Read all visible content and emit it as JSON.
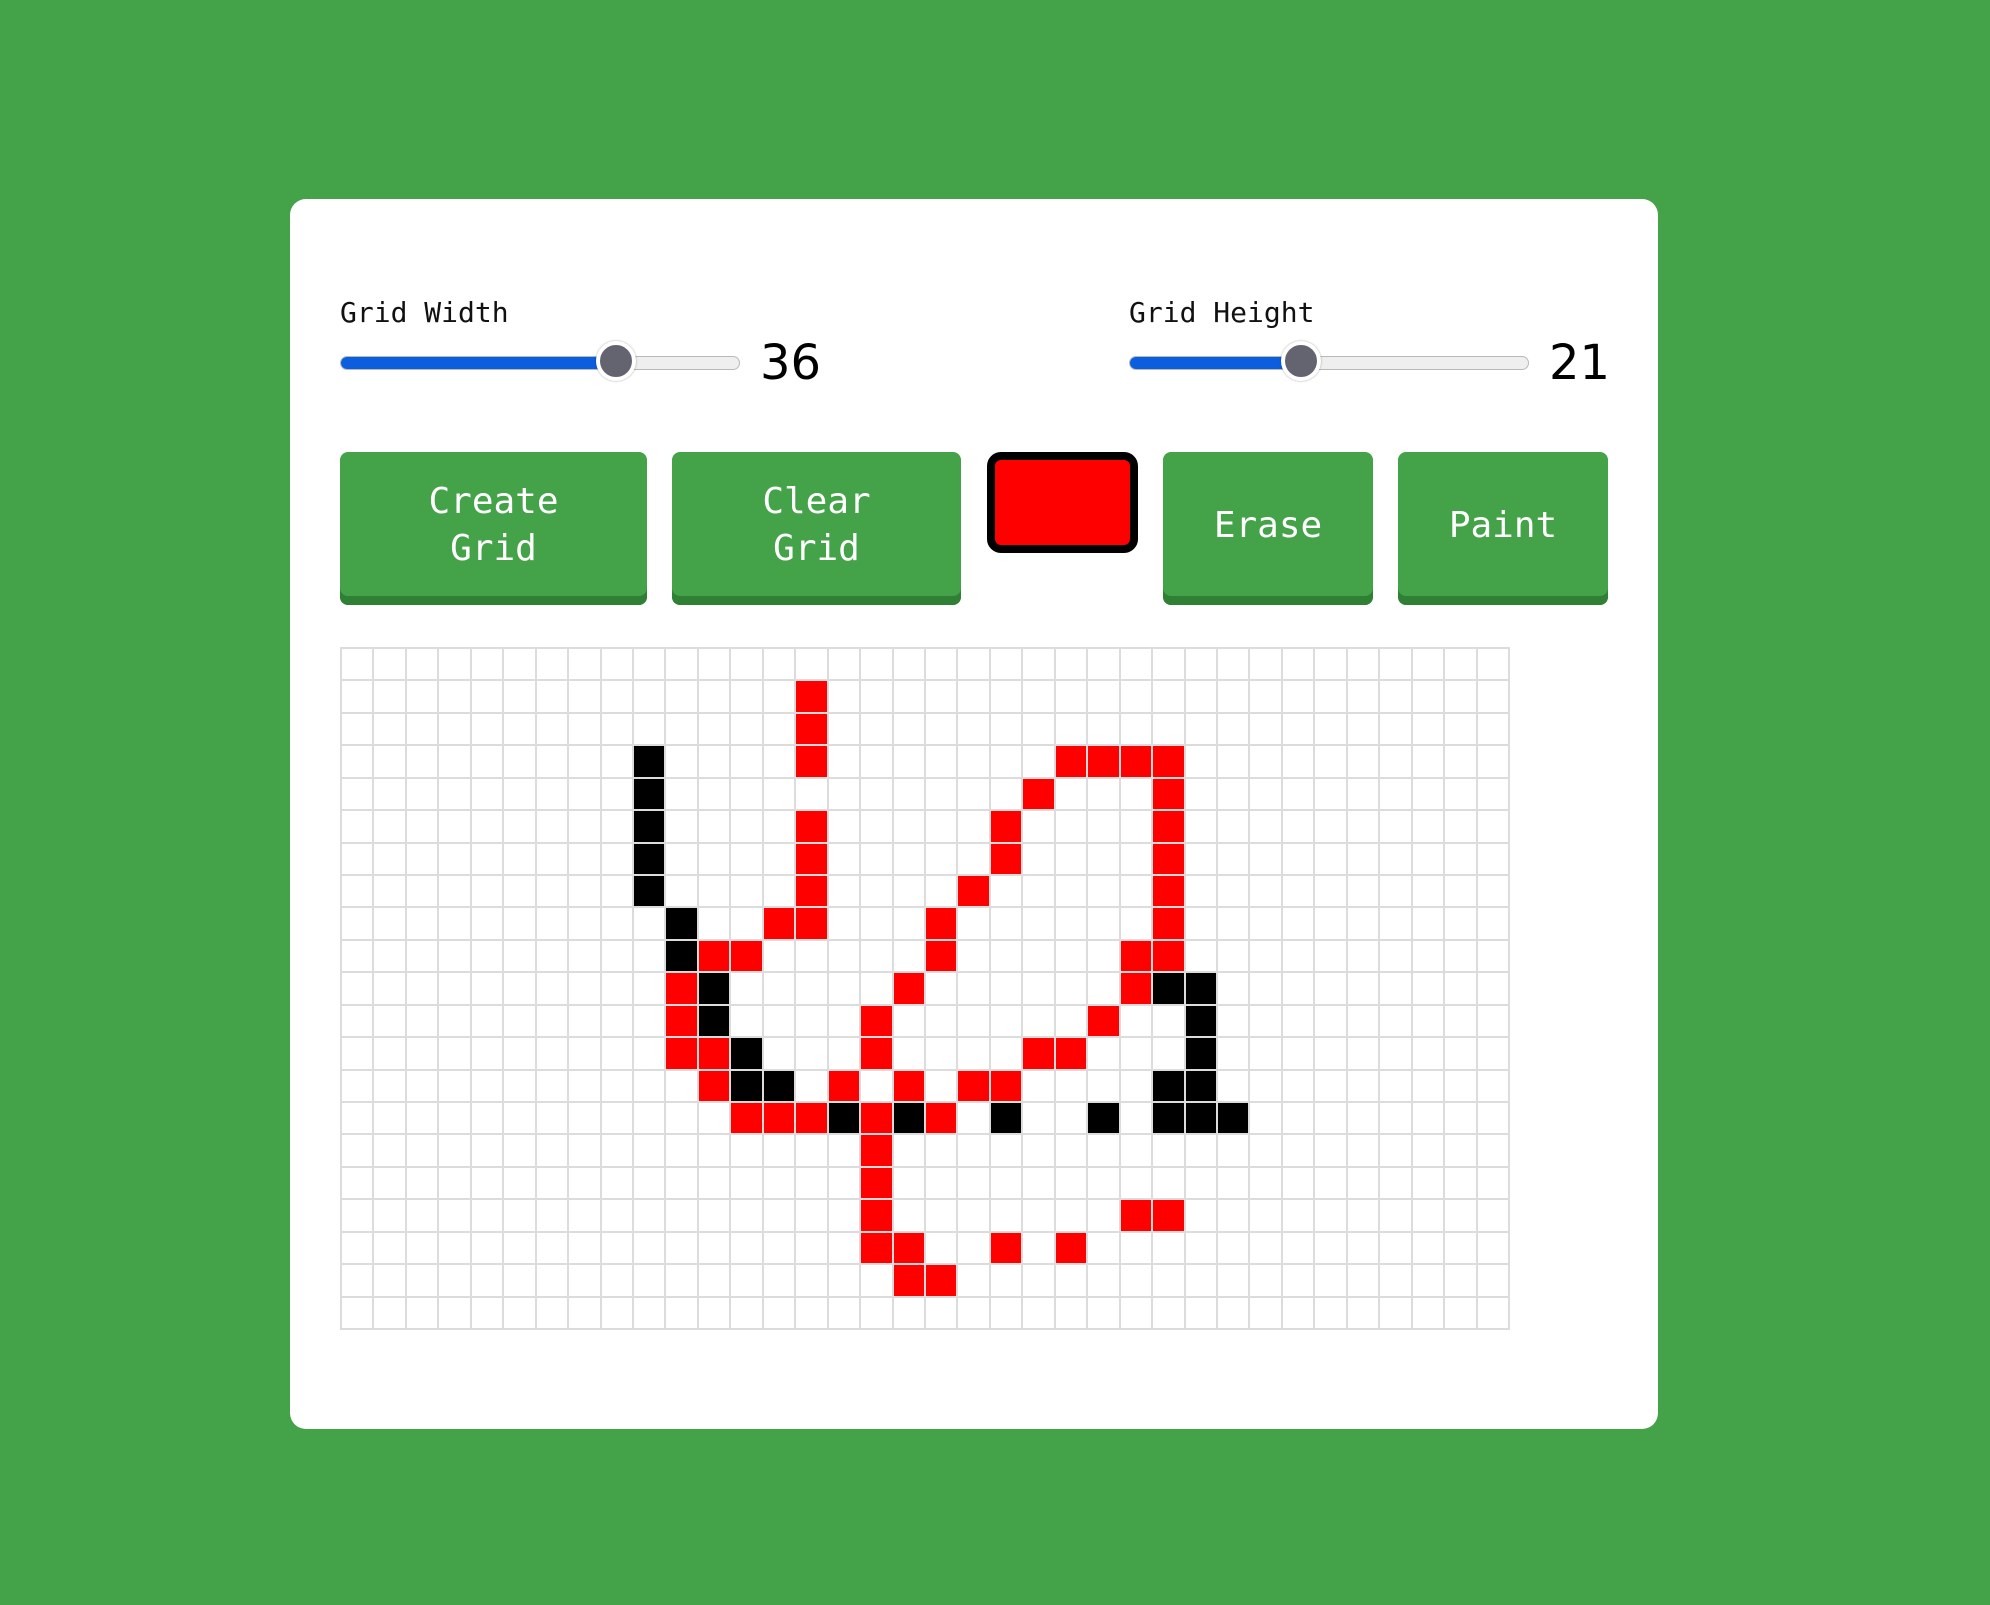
{
  "colors": {
    "background": "#44a249",
    "button": "#44a249",
    "slider_fill": "#0b5fde",
    "paint_red": "#ff0000",
    "paint_black": "#000000"
  },
  "controls": {
    "grid_width": {
      "label": "Grid Width",
      "value": "36",
      "min": 1,
      "max": 64,
      "fraction": 0.69
    },
    "grid_height": {
      "label": "Grid Height",
      "value": "21",
      "min": 1,
      "max": 50,
      "fraction": 0.43
    }
  },
  "buttons": {
    "create_grid": [
      "Create",
      "Grid"
    ],
    "clear_grid": [
      "Clear",
      "Grid"
    ],
    "erase": "Erase",
    "paint": "Paint"
  },
  "selected_color": "#ff0000",
  "grid": {
    "columns": 36,
    "rows": 21,
    "pixels": [
      "....................................",
      "..............R.....................",
      "..............R.....................",
      ".........B....R.......RRRR..........",
      ".........B...........R...R..........",
      ".........B....R.....R....R..........",
      ".........B....R.....R....R..........",
      ".........B....R....R.....R..........",
      "..........B..RR...R......R..........",
      "..........BRR.....R.....RR..........",
      "..........RB.....R......RBB.........",
      "..........RB....R......R..B.........",
      "..........RRB...R....RR...B.........",
      "...........RBB.R.R.RR....BB.........",
      "............RRRBRBR.B..B.BBB........",
      "................R...................",
      "................R...................",
      "................R.......RR..........",
      "................RR..R.R.............",
      ".................RR.................",
      "...................................."
    ]
  }
}
